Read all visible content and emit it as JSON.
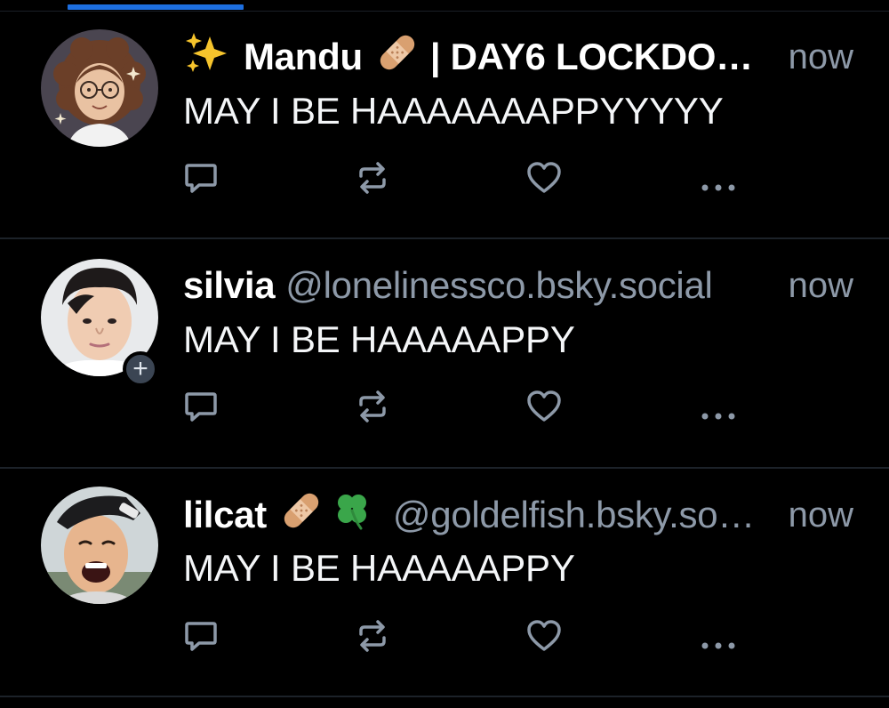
{
  "colors": {
    "background": "#000000",
    "accent": "#1d6fe0",
    "muted_text": "#8d99a8",
    "icon": "#8d99a8",
    "divider": "#1c2229"
  },
  "posts": [
    {
      "display_name": "Mandu",
      "name_suffix": "| DAY6 LOCKDO…",
      "handle": "",
      "timestamp": "now",
      "text": "MAY I BE HAAAAAAAPPYYYYY",
      "avatar": "cartoon-curly-hair-avatar",
      "emojis": [
        "sparkles",
        "adhesive-bandage"
      ]
    },
    {
      "display_name": "silvia",
      "name_suffix": "",
      "handle": "@lonelinessco.bsky.social",
      "timestamp": "now",
      "text": "MAY I BE HAAAAAPPY",
      "avatar": "photo-avatar",
      "follow_badge": "+"
    },
    {
      "display_name": "lilcat",
      "name_suffix": "",
      "handle": "@goldelfish.bsky.so…",
      "timestamp": "now",
      "text": "MAY I BE HAAAAAPPY",
      "avatar": "photo-avatar",
      "emojis": [
        "adhesive-bandage",
        "four-leaf-clover"
      ]
    }
  ],
  "actions": [
    "reply",
    "repost",
    "like",
    "more"
  ]
}
